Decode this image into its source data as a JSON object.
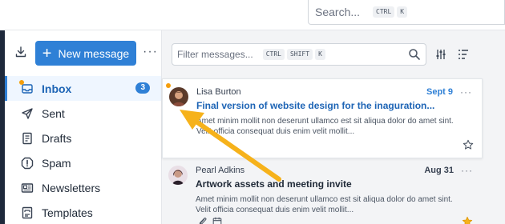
{
  "top_search": {
    "placeholder": "Search...",
    "kbd": [
      "CTRL",
      "K"
    ]
  },
  "sidebar": {
    "new_message_label": "New message",
    "more_label": "···",
    "items": [
      {
        "label": "Inbox",
        "icon": "inbox-icon",
        "count": "3",
        "active": true
      },
      {
        "label": "Sent",
        "icon": "send-icon"
      },
      {
        "label": "Drafts",
        "icon": "drafts-icon"
      },
      {
        "label": "Spam",
        "icon": "spam-icon"
      },
      {
        "label": "Newsletters",
        "icon": "newsletter-icon"
      },
      {
        "label": "Templates",
        "icon": "template-icon"
      }
    ]
  },
  "list": {
    "filter_placeholder": "Filter messages...",
    "filter_kbd": [
      "CTRL",
      "SHIFT",
      "K"
    ],
    "messages": [
      {
        "sender": "Lisa Burton",
        "date": "Sept 9",
        "subject": "Final version of website design for the inaguration...",
        "preview": "Amet minim mollit non deserunt ullamco est sit aliqua dolor do amet sint. Velit officia consequat duis enim velit mollit...",
        "unread": true
      },
      {
        "sender": "Pearl Adkins",
        "date": "Aug 31",
        "subject": "Artwork assets and meeting invite",
        "preview": "Amet minim mollit non deserunt ullamco est sit aliqua dolor do amet sint. Velit officia consequat duis enim velit mollit...",
        "unread": false
      }
    ]
  },
  "colors": {
    "accent": "#2f80d6",
    "annotation_arrow": "#f6b21b",
    "unread_dot": "#f59e0b",
    "rail": "#1e293b"
  }
}
